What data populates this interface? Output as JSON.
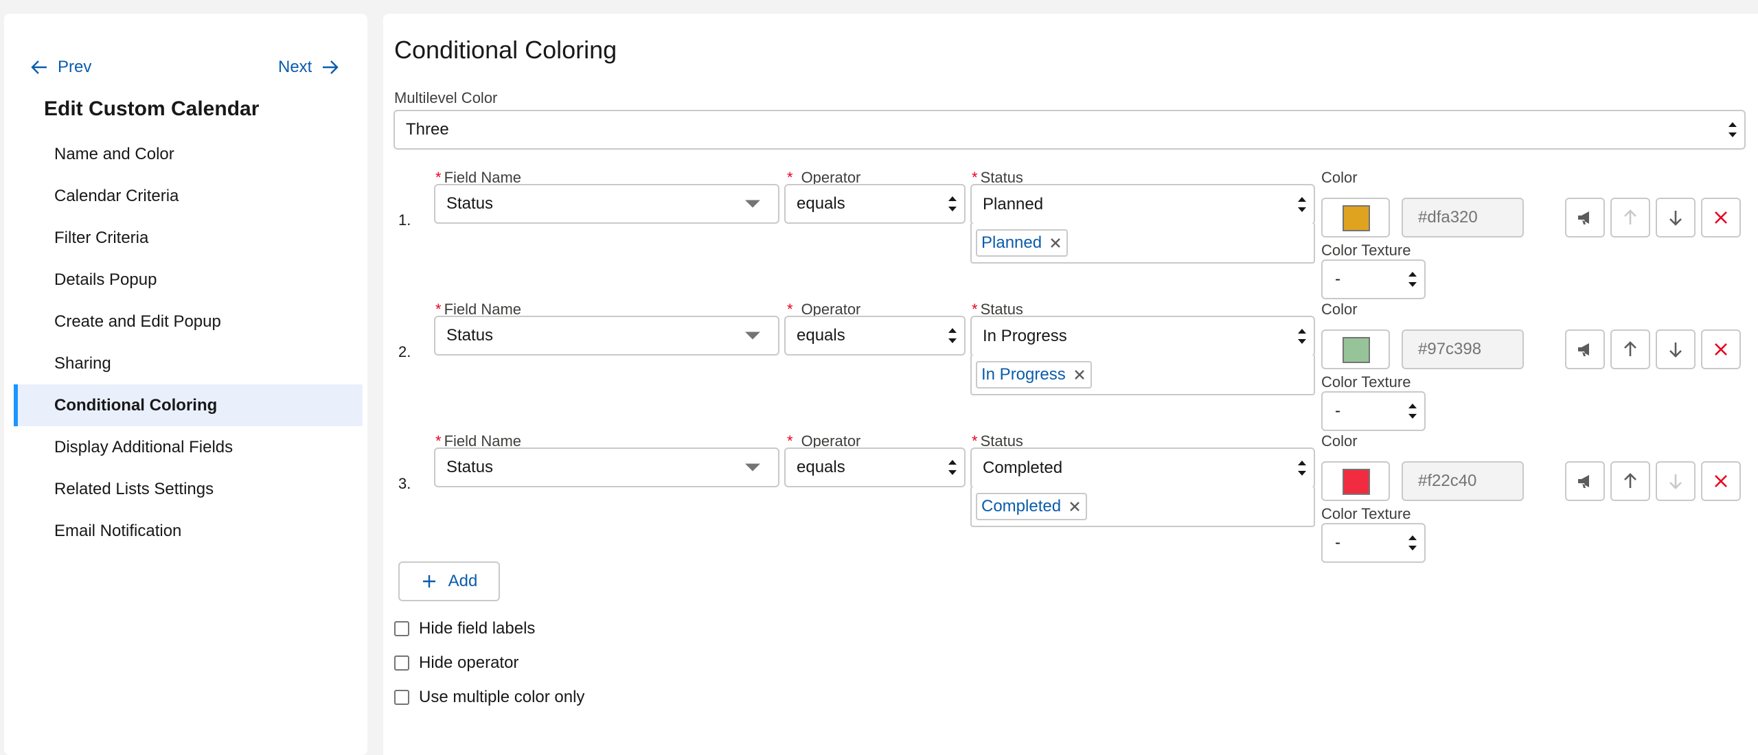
{
  "sidebar": {
    "prev_label": "Prev",
    "next_label": "Next",
    "title": "Edit Custom Calendar",
    "items": [
      {
        "label": "Name and Color"
      },
      {
        "label": "Calendar Criteria"
      },
      {
        "label": "Filter Criteria"
      },
      {
        "label": "Details Popup"
      },
      {
        "label": "Create and Edit Popup"
      },
      {
        "label": "Sharing"
      },
      {
        "label": "Conditional Coloring",
        "active": true
      },
      {
        "label": "Display Additional Fields"
      },
      {
        "label": "Related Lists Settings"
      },
      {
        "label": "Email Notification"
      }
    ]
  },
  "main": {
    "title": "Conditional Coloring",
    "multilevel_label": "Multilevel Color",
    "multilevel_value": "Three",
    "labels": {
      "field_name": "Field Name",
      "operator": "Operator",
      "status": "Status",
      "color": "Color",
      "color_texture": "Color Texture",
      "required_mark": "*"
    },
    "rules": [
      {
        "num": "1.",
        "field": "Status",
        "operator": "equals",
        "status": "Planned",
        "pill": "Planned",
        "color": "#dfa320",
        "texture": "-",
        "up_enabled": false,
        "down_enabled": true
      },
      {
        "num": "2.",
        "field": "Status",
        "operator": "equals",
        "status": "In Progress",
        "pill": "In Progress",
        "color": "#97c398",
        "texture": "-",
        "up_enabled": true,
        "down_enabled": true
      },
      {
        "num": "3.",
        "field": "Status",
        "operator": "equals",
        "status": "Completed",
        "pill": "Completed",
        "color": "#f22c40",
        "texture": "-",
        "up_enabled": true,
        "down_enabled": false
      }
    ],
    "add_label": "Add",
    "options": {
      "hide_field_labels": "Hide field labels",
      "hide_operator": "Hide operator",
      "use_multiple_color_only": "Use multiple color only"
    }
  },
  "colors": {
    "accent": "#0b5cab",
    "active_bar": "#1b96ff",
    "active_bg": "#eaf0fb",
    "required": "#ea001e",
    "delete": "#ea001e"
  }
}
